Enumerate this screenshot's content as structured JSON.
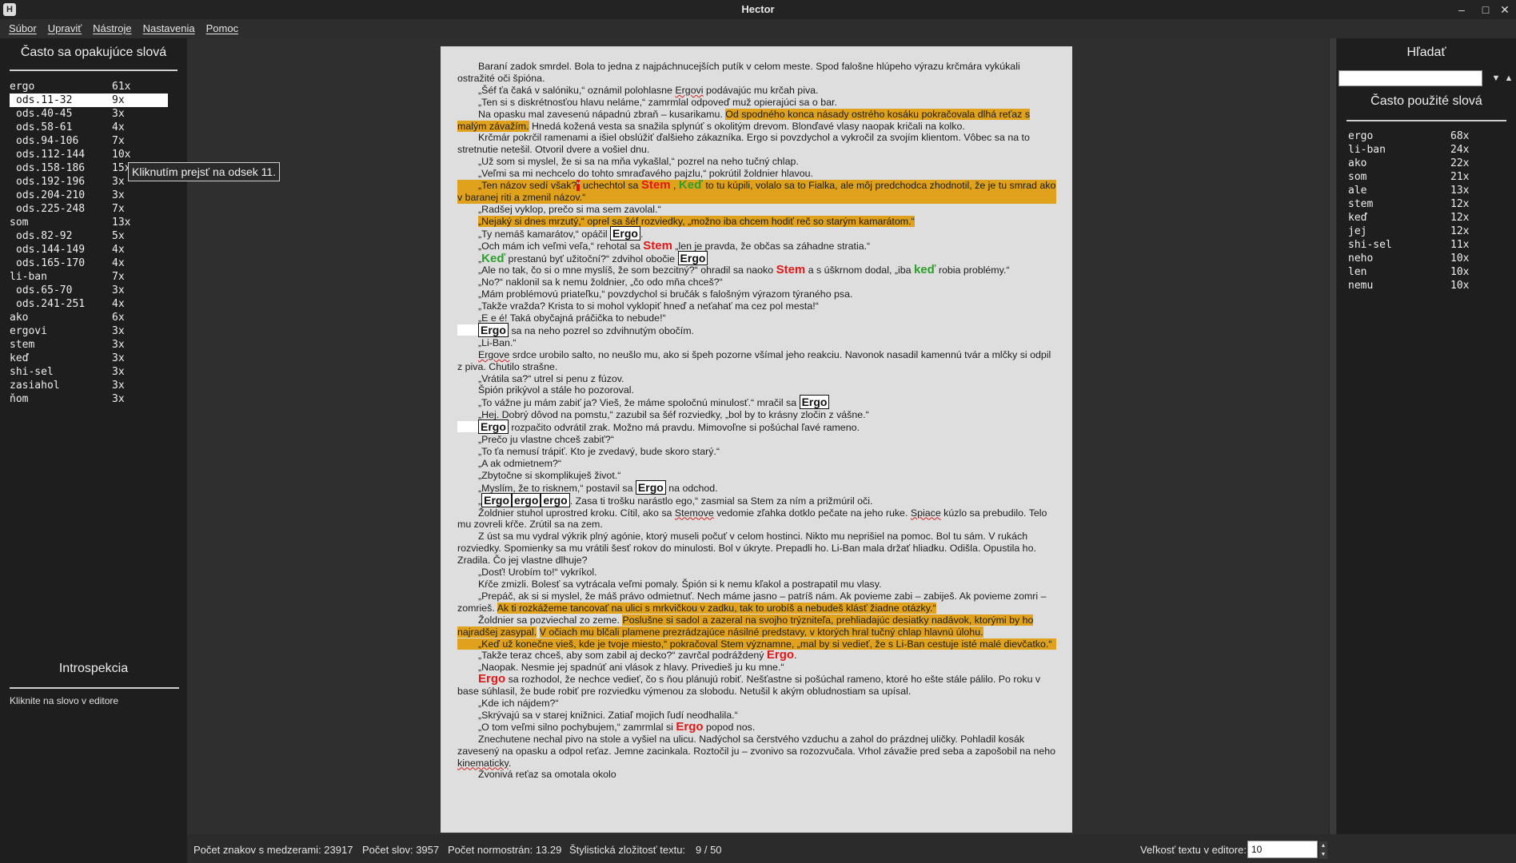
{
  "window": {
    "title": "Hector",
    "app_icon": "H"
  },
  "menu": [
    "Súbor",
    "Upraviť",
    "Nástroje",
    "Nastavenia",
    "Pomoc"
  ],
  "left": {
    "title": "Často sa opakujúce slová",
    "rows": [
      {
        "w": "ergo",
        "c": "61x",
        "sub": false
      },
      {
        "w": "ods.11-32",
        "c": "9x",
        "sub": true,
        "selected": true
      },
      {
        "w": "ods.40-45",
        "c": "3x",
        "sub": true
      },
      {
        "w": "ods.58-61",
        "c": "4x",
        "sub": true
      },
      {
        "w": "ods.94-106",
        "c": "7x",
        "sub": true
      },
      {
        "w": "ods.112-144",
        "c": "10x",
        "sub": true
      },
      {
        "w": "ods.158-186",
        "c": "15x",
        "sub": true
      },
      {
        "w": "ods.192-196",
        "c": "3x",
        "sub": true
      },
      {
        "w": "ods.204-210",
        "c": "3x",
        "sub": true
      },
      {
        "w": "ods.225-248",
        "c": "7x",
        "sub": true
      },
      {
        "w": "som",
        "c": "13x",
        "sub": false
      },
      {
        "w": "ods.82-92",
        "c": "5x",
        "sub": true
      },
      {
        "w": "ods.144-149",
        "c": "4x",
        "sub": true
      },
      {
        "w": "ods.165-170",
        "c": "4x",
        "sub": true
      },
      {
        "w": "li-ban",
        "c": "7x",
        "sub": false
      },
      {
        "w": "ods.65-70",
        "c": "3x",
        "sub": true
      },
      {
        "w": "ods.241-251",
        "c": "4x",
        "sub": true
      },
      {
        "w": "ako",
        "c": "6x",
        "sub": false
      },
      {
        "w": "ergovi",
        "c": "3x",
        "sub": false
      },
      {
        "w": "stem",
        "c": "3x",
        "sub": false
      },
      {
        "w": "keď",
        "c": "3x",
        "sub": false
      },
      {
        "w": "shi-sel",
        "c": "3x",
        "sub": false
      },
      {
        "w": "zasiahol",
        "c": "3x",
        "sub": false
      },
      {
        "w": "ňom",
        "c": "3x",
        "sub": false
      }
    ],
    "tooltip": "Kliknutím prejsť na odsek 11.",
    "introspection_title": "Introspekcia",
    "introspection_hint": "Kliknite na slovo v editore"
  },
  "right": {
    "search_title": "Hľadať",
    "search_value": "",
    "down_arrow": "▼",
    "up_arrow": "▲",
    "used_title": "Často použité slová",
    "rows": [
      {
        "w": "ergo",
        "c": "68x"
      },
      {
        "w": "li-ban",
        "c": "24x"
      },
      {
        "w": "ako",
        "c": "22x"
      },
      {
        "w": "som",
        "c": "21x"
      },
      {
        "w": "ale",
        "c": "13x"
      },
      {
        "w": "stem",
        "c": "12x"
      },
      {
        "w": "keď",
        "c": "12x"
      },
      {
        "w": "jej",
        "c": "12x"
      },
      {
        "w": "shi-sel",
        "c": "11x"
      },
      {
        "w": "neho",
        "c": "10x"
      },
      {
        "w": "len",
        "c": "10x"
      },
      {
        "w": "nemu",
        "c": "10x"
      }
    ]
  },
  "status": {
    "chars": "Počet znakov s medzerami: 23917",
    "words": "Počet slov: 3957",
    "pages": "Počet normostrán: 13.29",
    "complexity_label": "Štylistická zložitosť textu:",
    "complexity_value": "9 / 50",
    "size_label": "Veľkosť textu v editore:",
    "size_value": "10"
  },
  "editor": {
    "tags": {
      "ergo": "Ergo",
      "ergo_lc": "ergo",
      "stem": "Stem",
      "ked": "Keď",
      "ked_lc": "keď"
    },
    "p": [
      "Baraní zadok smrdel. Bola to jedna z najpáchnucejších putík v celom meste. Spod falošne hlúpeho výrazu krčmára vykúkali ostražité oči špióna.",
      "„Šéf ťa čaká v salóniku,“ oznámil polohlasne",
      "Ergovi",
      " podávajúc mu krčah piva.",
      "„Ten si s diskrétnosťou hlavu neláme,“ zamrmlal odpoveď muž opierajúci sa o bar.",
      "Na opasku mal zavesenú nápadnú zbraň – kusarikamu.",
      "Od spodného konca násady ostrého kosáku pokračovala dlhá reťaz s malým závažím.",
      " Hnedá kožená vesta sa snažila splynúť s okolitým drevom. Blonďavé vlasy naopak kričali na kolko.",
      "Krčmár pokrčil ramenami a išiel obslúžiť ďalšieho zákazníka. Ergo si povzdychol a vykročil za svojím klientom. Vôbec sa na to stretnutie netešil. Otvoril dvere a vošiel dnu.",
      "„Už som si myslel, že si sa na mňa vykašlal,“ pozrel na neho tučný chlap.",
      "„Veľmi sa mi nechcelo do tohto smraďavého pajzlu,“ pokrútil žoldnier hlavou.",
      "„Ten názov sedí však?",
      "“",
      " uchechtol sa ",
      " , ",
      " to tu kúpili, volalo sa to Fialka, ale môj predchodca zhodnotil, že je tu smrad ako v baranej riti a zmenil názov.“",
      "„Radšej vyklop, prečo si ma sem zavolal.“",
      "„Nejaký si dnes mrzutý,“ oprel sa šéf rozviedky, „možno iba chcem hodiť reč so starým kamarátom.“",
      "„Ty nemáš kamarátov,“ opáčil ",
      ".",
      "„Och mám ich veľmi veľa,“ rehotal sa ",
      " „len je pravda, že občas sa záhadne stratia.“",
      "„",
      " prestanú byť užitoční?“ zdvihol obočie ",
      "„Ale no tak, čo si o mne myslíš, že som bezcitný?“ ohradil sa naoko ",
      " a s úškrnom dodal, „iba ",
      " robia problémy.“",
      "„No?“ naklonil sa k nemu žoldnier, „čo odo mňa chceš?“",
      "„Mám problémovú priateľku,“ povzdychol si bručák s falošným výrazom týraného psa.",
      "„Takže vražda? Krista to si mohol vyklopiť hneď a neťahať ma cez pol mesta!“",
      "„E e é! Taká obyčajná práčička to nebude!“",
      " sa na neho pozrel so zdvihnutým obočím.",
      "„Li-Ban.“",
      "Ergove",
      " srdce urobilo salto, no neušlo mu, ako si špeh pozorne všímal jeho reakciu. Navonok nasadil kamennú tvár a mlčky si odpil z piva. Chutilo strašne.",
      "„Vrátila sa?“ utrel si penu z fúzov.",
      "Špión prikývol a stále ho pozoroval.",
      "„To vážne ju mám zabiť ja? Vieš, že máme spoločnú minulosť.“ mračil sa ",
      "„Hej. Dobrý dôvod na pomstu,“ zazubil sa šéf rozviedky, „bol by to krásny zločin z vášne.“",
      " rozpačito odvrátil zrak. Možno má pravdu. Mimovoľne si pošúchal ľavé rameno.",
      "„Prečo ju vlastne chceš zabiť?“",
      "„To ťa nemusí trápiť. Kto je zvedavý, bude skoro starý.“",
      "„A ak odmietnem?“",
      "„Zbytočne si skomplikuješ život.“",
      "„Myslím, že to risknem,“ postavil sa ",
      " na odchod.",
      ". Zasa ti trošku narástlo ego,“ zasmial sa Stem za ním a prižmúril oči.",
      "Žoldnier stuhol uprostred kroku. Cítil, ako sa ",
      "Stemove",
      " vedomie zľahka dotklo pečate na jeho ruke. ",
      "Spiace",
      " kúzlo sa prebudilo. Telo mu zovreli kŕče. Zrútil sa na zem.",
      "Z úst sa mu vydral výkrik plný agónie, ktorý museli počuť v celom hostinci. Nikto mu neprišiel na pomoc. Bol tu sám. V rukách rozviedky. Spomienky sa mu vrátili šesť rokov do minulosti. Bol v úkryte. Prepadli ho. Li-Ban mala držať hliadku. Odišla. Opustila ho. Zradila. Čo jej vlastne dlhuje?",
      "„Dosť! Urobím to!“ vykríkol.",
      "Kŕče zmizli. Bolesť sa vytrácala veľmi pomaly. Špión si k nemu kľakol a postrapatil mu vlasy.",
      "„Prepáč, ak si si myslel, že máš právo odmietnuť. Nech máme jasno – patríš nám. Ak povieme zabi – zabiješ. Ak povieme zomri – zomrieš. ",
      "Ak ti rozkážeme tancovať na ulici s mrkvičkou v zadku, tak to urobíš a nebudeš klásť žiadne otázky.“",
      "Žoldnier sa pozviechal zo zeme. ",
      "Poslušne si sadol a zazeral na svojho trýzniteľa, prehliadajúc desiatky nadávok, ktorými by ho najradšej zasypal.",
      " ",
      "V očiach mu blčali plamene prezrádzajúce násilné predstavy, v ktorých hral tučný chlap hlavnú úlohu.",
      "„Keď už konečne vieš, kde je tvoje miesto,“ pokračoval Stem významne, „mal by si vedieť, že s Li-Ban cestuje isté malé dievčatko.“",
      "„Takže teraz chceš, aby som zabil aj decko?“ zavrčal podráždený ",
      "„Naopak. Nesmie jej spadnúť ani vlások z hlavy. Privedieš ju ku mne.“",
      " sa rozhodol, že nechce vedieť, čo s ňou plánujú robiť. Nešťastne si pošúchal rameno, ktoré ho ešte stále pálilo. Po roku v base súhlasil, že bude robiť pre rozviedku výmenou za slobodu. Netušil k akým obludnostiam sa upísal.",
      "„Kde ich nájdem?“",
      "„Skrývajú sa v starej knižnici. Zatiaľ mojich ľudí neodhalila.“",
      "„O tom veľmi silno pochybujem,“ zamrmlal si ",
      " popod nos.",
      "Znechutene nechal pivo na stole a vyšiel na ulicu. Nadýchol sa čerstvého vzduchu a zahol do prázdnej uličky. Pohladil kosák zavesený na opasku a odpol reťaz. Jemne zacinkala. Roztočil ju – zvonivo sa rozozvučala. Vrhol závažie pred seba a zapošobil na neho ",
      "kinematicky",
      ".",
      "Zvonivá reťaz sa omotala okolo"
    ]
  }
}
